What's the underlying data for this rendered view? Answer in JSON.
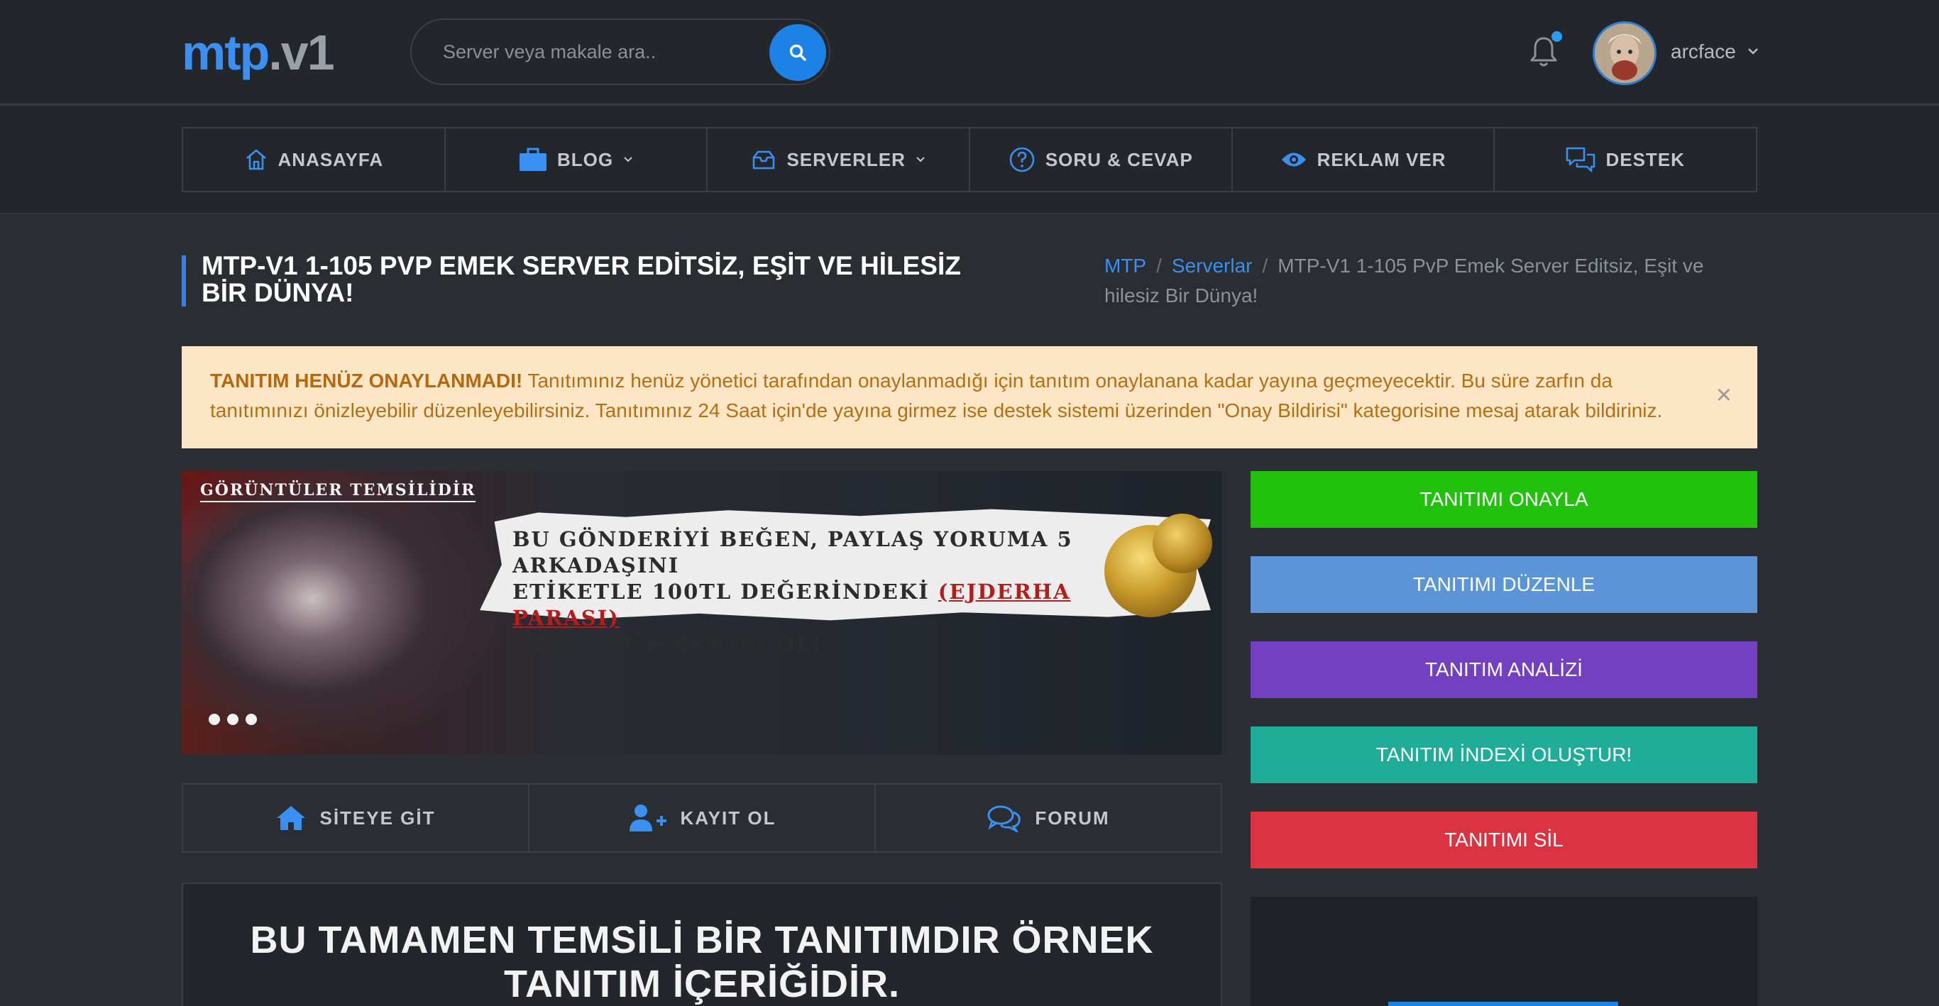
{
  "header": {
    "logo_part1": "mtp",
    "logo_part2": ".v1",
    "search_placeholder": "Server veya makale ara..",
    "username": "arcface"
  },
  "nav": {
    "items": [
      {
        "label": "ANASAYFA",
        "icon": "home-icon"
      },
      {
        "label": "BLOG",
        "icon": "briefcase-icon",
        "dropdown": true
      },
      {
        "label": "SERVERLER",
        "icon": "inbox-icon",
        "dropdown": true
      },
      {
        "label": "SORU & CEVAP",
        "icon": "question-icon"
      },
      {
        "label": "REKLAM VER",
        "icon": "eye-icon"
      },
      {
        "label": "DESTEK",
        "icon": "chat-icon"
      }
    ]
  },
  "page": {
    "title": "MTP-V1 1-105 PVP EMEK SERVER EDİTSİZ, EŞİT VE HİLESİZ BİR DÜNYA!",
    "breadcrumb": [
      "MTP",
      "Serverlar",
      "MTP-V1 1-105 PvP Emek Server Editsiz, Eşit ve hilesiz Bir Dünya!"
    ]
  },
  "alert": {
    "bold": "TANITIM HENÜZ ONAYLANMADI!",
    "text": "Tanıtımınız henüz yönetici tarafından onaylanmadığı için tanıtım onaylanana kadar yayına geçmeyecektir. Bu süre zarfın da tanıtımınızı önizleyebilir düzenleyebilirsiniz. Tanıtımınız 24 Saat için'de yayına girmez ise destek sistemi üzerinden \"Onay Bildirisi\" kategorisine mesaj atarak bildiriniz.",
    "close": "×"
  },
  "banner": {
    "tag": "GÖRÜNTÜLER TEMSİLİDİR",
    "line1": "BU GÖNDERİYİ BEĞEN, PAYLAŞ YORUMA 5 ARKADAŞINI",
    "line2_a": "ETİKETLE 100TL DEĞERİNDEKİ",
    "line2_b": "(EJDERHA PARASI)",
    "line3": "ÖDÜLÜNÜN SAHİBİ OL!"
  },
  "links": [
    {
      "label": "SİTEYE GİT",
      "icon": "home-icon"
    },
    {
      "label": "KAYIT OL",
      "icon": "user-plus-icon"
    },
    {
      "label": "FORUM",
      "icon": "comments-icon"
    }
  ],
  "content": {
    "title": "BU TAMAMEN TEMSİLİ BİR TANITIMDIR ÖRNEK TANITIM İÇERİĞİDİR."
  },
  "actions": [
    {
      "label": "TANITIMI ONAYLA",
      "color": "#22c10e"
    },
    {
      "label": "TANITIMI DÜZENLE",
      "color": "#5b95d8"
    },
    {
      "label": "TANITIM ANALİZİ",
      "color": "#7340c2"
    },
    {
      "label": "TANITIM İNDEXİ OLUŞTUR!",
      "color": "#1fad9a"
    },
    {
      "label": "TANITIMI SİL",
      "color": "#dc3342"
    }
  ],
  "colors": {
    "accent": "#1d82e6",
    "background": "#2a2d31",
    "alert_bg": "#fde6c5",
    "alert_text": "#b56f12"
  }
}
